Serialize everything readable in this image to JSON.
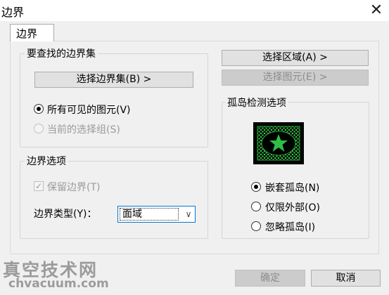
{
  "window": {
    "title": "边界",
    "close_glyph": "✕"
  },
  "tab": {
    "label": "边界"
  },
  "boundary_set": {
    "legend": "要查找的边界集",
    "select_button": "选择边界集(B) >",
    "radio_all_visible": "所有可见的图元(V)",
    "radio_current_selection": "当前的选择组(S)"
  },
  "boundary_options": {
    "legend": "边界选项",
    "keep_boundary": "保留边界(T)",
    "type_label": "边界类型(Y)：",
    "type_value": "面域"
  },
  "right": {
    "select_area": "选择区域(A) >",
    "select_element": "选择图元(E) >"
  },
  "island": {
    "legend": "孤岛检测选项",
    "option_nested": "嵌套孤岛(N)",
    "option_outer": "仅限外部(O)",
    "option_ignore": "忽略孤岛(I)"
  },
  "footer": {
    "ok": "确定",
    "cancel": "取消"
  },
  "watermark": {
    "line1": "真空技术网",
    "line2": "chvacuum.com"
  }
}
